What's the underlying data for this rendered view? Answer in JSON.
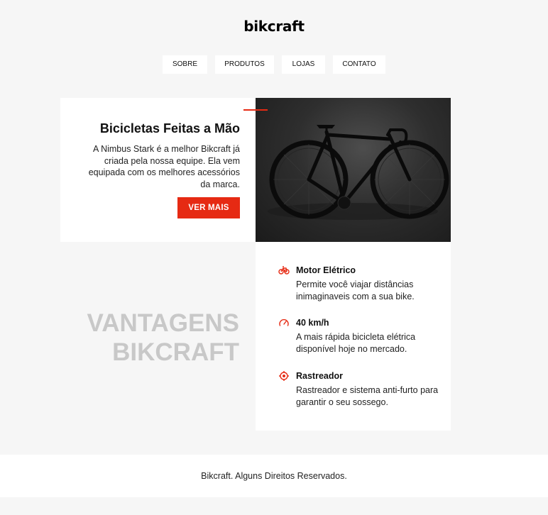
{
  "header": {
    "logo": "bikcraft"
  },
  "nav": {
    "items": [
      {
        "label": "SOBRE"
      },
      {
        "label": "PRODUTOS"
      },
      {
        "label": "LOJAS"
      },
      {
        "label": "CONTATO"
      }
    ]
  },
  "intro": {
    "title": "Bicicletas Feitas a Mão",
    "text": "A Nimbus Stark é a melhor Bikcraft já criada pela nossa equipe. Ela vem equipada com os melhores acessórios da marca.",
    "button": "VER MAIS"
  },
  "vantagens": {
    "line1": "VANTAGENS",
    "line2": "BIKCRAFT"
  },
  "features": [
    {
      "title": "Motor Elétrico",
      "text": "Permite você viajar distâncias inimaginaveis com a sua bike.",
      "icon": "bike-icon"
    },
    {
      "title": "40 km/h",
      "text": "A mais rápida bicicleta elétrica disponível hoje no mercado.",
      "icon": "speedometer-icon"
    },
    {
      "title": "Rastreador",
      "text": "Rastreador e sistema anti-furto para garantir o seu sossego.",
      "icon": "target-icon"
    }
  ],
  "footer": {
    "text": "Bikcraft. Alguns Direitos Reservados."
  },
  "colors": {
    "accent": "#e62a13",
    "background": "#f6f6f6",
    "muted_heading": "#c8c8c8"
  }
}
